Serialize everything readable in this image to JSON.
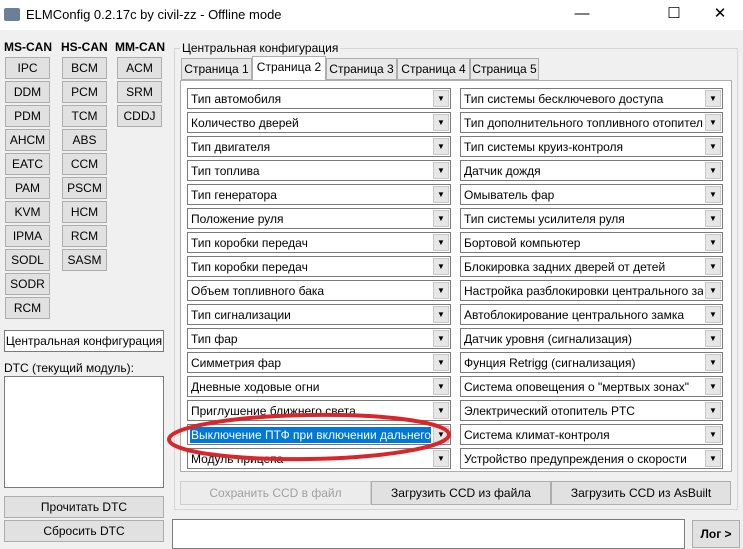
{
  "window": {
    "title": "ELMConfig 0.2.17c by civil-zz - Offline mode",
    "minimize": "—",
    "maximize": "☐",
    "close": "✕"
  },
  "modules": {
    "ms_can": {
      "label": "MS-CAN",
      "items": [
        "IPC",
        "DDM",
        "PDM",
        "AHCM",
        "EATC",
        "PAM",
        "KVM",
        "IPMA",
        "SODL",
        "SODR",
        "RCM"
      ]
    },
    "hs_can": {
      "label": "HS-CAN",
      "items": [
        "BCM",
        "PCM",
        "TCM",
        "ABS",
        "CCM",
        "PSCM",
        "HCM",
        "RCM",
        "SASM"
      ]
    },
    "mm_can": {
      "label": "MM-CAN",
      "items": [
        "ACM",
        "SRM",
        "CDDJ"
      ]
    }
  },
  "central_config_button": "Центральная конфигурация",
  "dtc": {
    "label": "DTC (текущий модуль):",
    "read": "Прочитать DTC",
    "clear": "Сбросить DTC"
  },
  "group": {
    "label": "Центральная конфигурация",
    "tabs": [
      "Страница 1",
      "Страница 2",
      "Страница 3",
      "Страница 4",
      "Страница 5"
    ],
    "active_tab": 1
  },
  "combos_left": [
    "Тип автомобиля",
    "Количество дверей",
    "Тип двигателя",
    "Тип топлива",
    "Тип генератора",
    "Положение руля",
    "Тип коробки передач",
    "Тип коробки передач",
    "Объем топливного бака",
    "Тип сигнализации",
    "Тип фар",
    "Симметрия фар",
    "Дневные ходовые огни",
    "Приглушение ближнего света",
    "Выключение ПТФ при включении дальнего св.",
    "Модуль прицепа"
  ],
  "combos_right": [
    "Тип системы бесключевого доступа",
    "Тип дополнительного топливного отопителя",
    "Тип системы круиз-контроля",
    "Датчик дождя",
    "Омыватель фар",
    "Тип системы усилителя руля",
    "Бортовой компьютер",
    "Блокировка задних дверей от детей",
    "Настройка разблокировки центрального замка",
    "Автоблокирование центрального замка",
    "Датчик уровня (сигнализация)",
    "Фунция Retrigg (сигнализация)",
    "Система оповещения о \"мертвых зонах\"",
    "Электрический отопитель PTC",
    "Система климат-контроля",
    "Устройство предупреждения о скорости"
  ],
  "selected_left_index": 14,
  "actions": {
    "save": "Сохранить CCD в файл",
    "load_file": "Загрузить CCD из файла",
    "load_asbuilt": "Загрузить CCD из AsBuilt"
  },
  "log_input": "",
  "log_button": "Лог >",
  "annotation_color": "#d9262b"
}
